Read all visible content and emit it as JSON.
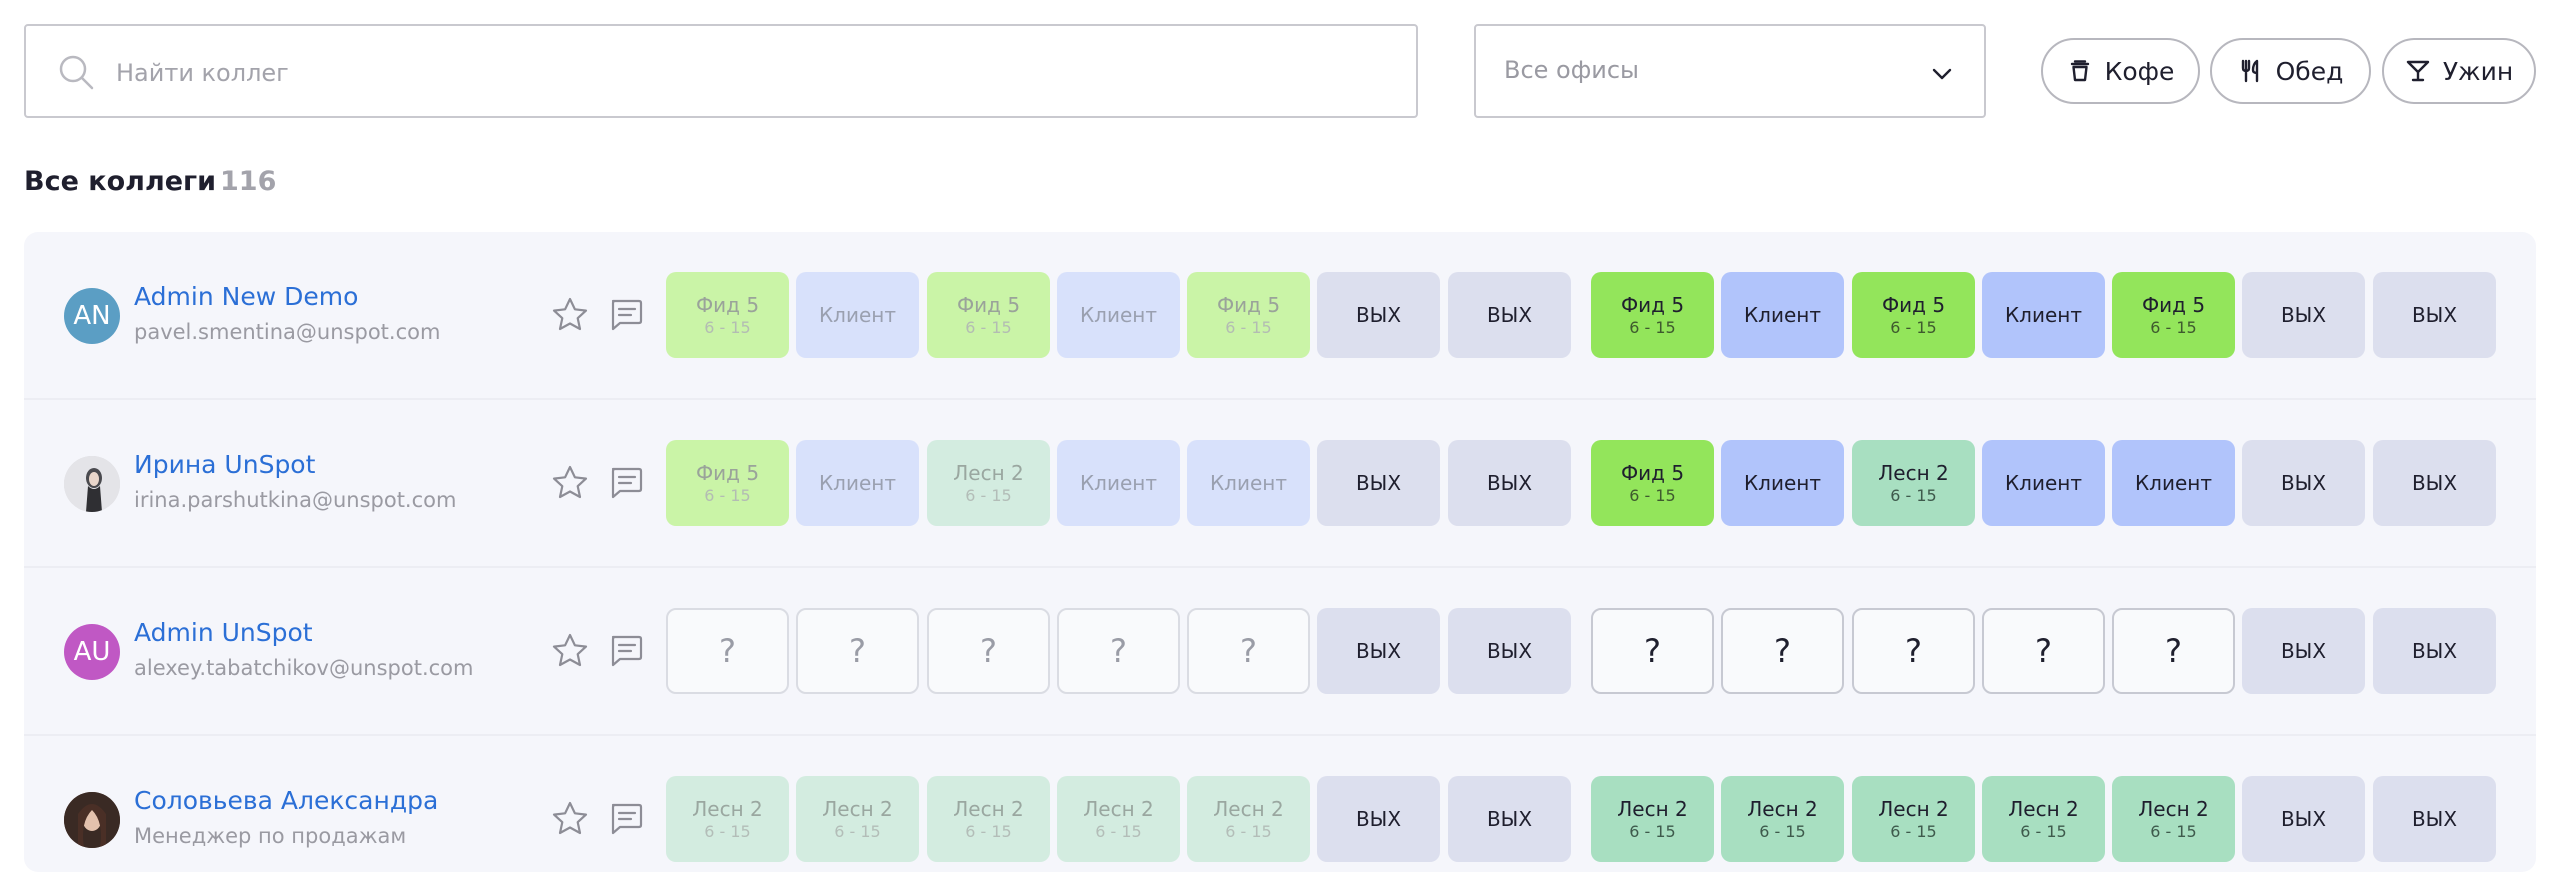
{
  "search": {
    "placeholder": "Найти коллег"
  },
  "office_select": {
    "selected": "Все офисы"
  },
  "filters": [
    {
      "label": "Кофе",
      "icon": "coffee-cup-icon"
    },
    {
      "label": "Обед",
      "icon": "fork-knife-icon"
    },
    {
      "label": "Ужин",
      "icon": "cocktail-glass-icon"
    }
  ],
  "list": {
    "title": "Все коллеги",
    "count": "116"
  },
  "rows": [
    {
      "name": "Admin New Demo",
      "subtitle": "pavel.smentina@unspot.com",
      "avatar": {
        "initials": "AN",
        "color": "#5b9ec4"
      },
      "week1": [
        {
          "title": "Фид 5",
          "time": "6 - 15"
        },
        {
          "title": "Клиент"
        },
        {
          "title": "Фид 5",
          "time": "6 - 15"
        },
        {
          "title": "Клиент"
        },
        {
          "title": "Фид 5",
          "time": "6 - 15"
        },
        {
          "title": "ВЫХ"
        },
        {
          "title": "ВЫХ"
        }
      ],
      "week2": [
        {
          "title": "Фид 5",
          "time": "6 - 15"
        },
        {
          "title": "Клиент"
        },
        {
          "title": "Фид 5",
          "time": "6 - 15"
        },
        {
          "title": "Клиент"
        },
        {
          "title": "Фид 5",
          "time": "6 - 15"
        },
        {
          "title": "ВЫХ"
        },
        {
          "title": "ВЫХ"
        }
      ]
    },
    {
      "name": "Ирина UnSpot",
      "subtitle": "irina.parshutkina@unspot.com",
      "avatar": {
        "initials": "",
        "color": "#d9d9de"
      },
      "week1": [
        {
          "title": "Фид 5",
          "time": "6 - 15"
        },
        {
          "title": "Клиент"
        },
        {
          "title": "Лесн 2",
          "time": "6 - 15"
        },
        {
          "title": "Клиент"
        },
        {
          "title": "Клиент"
        },
        {
          "title": "ВЫХ"
        },
        {
          "title": "ВЫХ"
        }
      ],
      "week2": [
        {
          "title": "Фид 5",
          "time": "6 - 15"
        },
        {
          "title": "Клиент"
        },
        {
          "title": "Лесн 2",
          "time": "6 - 15"
        },
        {
          "title": "Клиент"
        },
        {
          "title": "Клиент"
        },
        {
          "title": "ВЫХ"
        },
        {
          "title": "ВЫХ"
        }
      ]
    },
    {
      "name": "Admin UnSpot",
      "subtitle": "alexey.tabatchikov@unspot.com",
      "avatar": {
        "initials": "AU",
        "color": "#c058c4"
      },
      "week1": [
        {
          "title": "?"
        },
        {
          "title": "?"
        },
        {
          "title": "?"
        },
        {
          "title": "?"
        },
        {
          "title": "?"
        },
        {
          "title": "ВЫХ"
        },
        {
          "title": "ВЫХ"
        }
      ],
      "week2": [
        {
          "title": "?"
        },
        {
          "title": "?"
        },
        {
          "title": "?"
        },
        {
          "title": "?"
        },
        {
          "title": "?"
        },
        {
          "title": "ВЫХ"
        },
        {
          "title": "ВЫХ"
        }
      ]
    },
    {
      "name": "Соловьева Александра",
      "subtitle": "Менеджер по продажам",
      "avatar": {
        "initials": "",
        "color": "#6b4c40"
      },
      "week1": [
        {
          "title": "Лесн 2",
          "time": "6 - 15"
        },
        {
          "title": "Лесн 2",
          "time": "6 - 15"
        },
        {
          "title": "Лесн 2",
          "time": "6 - 15"
        },
        {
          "title": "Лесн 2",
          "time": "6 - 15"
        },
        {
          "title": "Лесн 2",
          "time": "6 - 15"
        },
        {
          "title": "ВЫХ"
        },
        {
          "title": "ВЫХ"
        }
      ],
      "week2": [
        {
          "title": "Лесн 2",
          "time": "6 - 15"
        },
        {
          "title": "Лесн 2",
          "time": "6 - 15"
        },
        {
          "title": "Лесн 2",
          "time": "6 - 15"
        },
        {
          "title": "Лесн 2",
          "time": "6 - 15"
        },
        {
          "title": "Лесн 2",
          "time": "6 - 15"
        },
        {
          "title": "ВЫХ"
        },
        {
          "title": "ВЫХ"
        }
      ]
    }
  ]
}
